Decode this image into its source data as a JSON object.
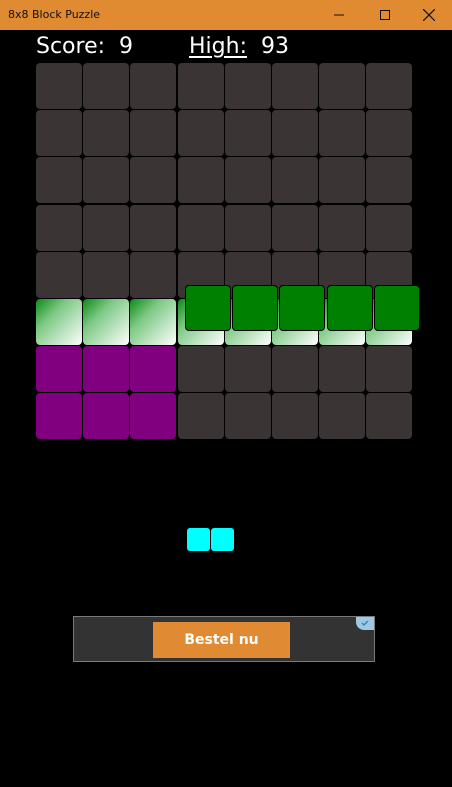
{
  "window": {
    "title": "8x8 Block Puzzle"
  },
  "header": {
    "score_label": "Score:",
    "score": "9",
    "high_label": "High:",
    "high": "93"
  },
  "board": {
    "size": 8,
    "rows": [
      [
        "empty",
        "empty",
        "empty",
        "empty",
        "empty",
        "empty",
        "empty",
        "empty"
      ],
      [
        "empty",
        "empty",
        "empty",
        "empty",
        "empty",
        "empty",
        "empty",
        "empty"
      ],
      [
        "empty",
        "empty",
        "empty",
        "empty",
        "empty",
        "empty",
        "empty",
        "empty"
      ],
      [
        "empty",
        "empty",
        "empty",
        "empty",
        "empty",
        "empty",
        "empty",
        "empty"
      ],
      [
        "empty",
        "empty",
        "empty",
        "empty",
        "empty",
        "empty",
        "empty",
        "empty"
      ],
      [
        "greenfade",
        "greenfade",
        "greenfade",
        "greenfade",
        "greenfade",
        "greenfade",
        "greenfade",
        "greenfade"
      ],
      [
        "purple",
        "purple",
        "purple",
        "empty",
        "empty",
        "empty",
        "empty",
        "empty"
      ],
      [
        "purple",
        "purple",
        "purple",
        "empty",
        "empty",
        "empty",
        "empty",
        "empty"
      ]
    ]
  },
  "dragged_piece": {
    "color": "#008000",
    "cells": 5,
    "shape": "horizontal-line"
  },
  "tray": {
    "piece": {
      "color": "#00ffff",
      "cells": 2,
      "shape": "horizontal-domino"
    }
  },
  "ad": {
    "button_label": "Bestel nu"
  },
  "colors": {
    "empty": "#3a3434",
    "purple": "#800080",
    "titlebar": "#e08a32",
    "ad_button": "#e08b33"
  }
}
